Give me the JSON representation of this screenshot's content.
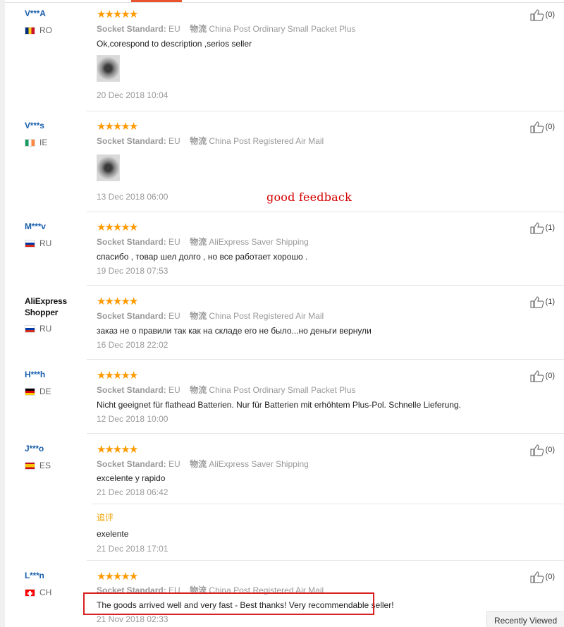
{
  "labels": {
    "socket_standard": "Socket Standard:",
    "logistics": "物流",
    "appended_review": "追评"
  },
  "watermark": "good feedback",
  "recently_viewed": "Recently Viewed",
  "rating_stars": 5,
  "reviews": [
    {
      "name": "V***A",
      "country": "RO",
      "flag_colors": [
        "#002b7f",
        "#fcd116",
        "#ce1126"
      ],
      "socket": "EU",
      "shipping": "China Post Ordinary Small Packet Plus",
      "text": "Ok,corespond to description ,serios seller",
      "has_photo": true,
      "date": "20 Dec 2018 10:04",
      "likes": "(0)"
    },
    {
      "name": "V***s",
      "country": "IE",
      "flag_colors": [
        "#169b62",
        "#ffffff",
        "#ff883e"
      ],
      "socket": "EU",
      "shipping": "China Post Registered Air Mail",
      "text": "",
      "has_photo": true,
      "date": "13 Dec 2018 06:00",
      "likes": "(0)"
    },
    {
      "name": "M***v",
      "country": "RU",
      "flag_colors": [
        "#ffffff",
        "#0039a6",
        "#d52b1e"
      ],
      "socket": "EU",
      "shipping": "AliExpress Saver Shipping",
      "text": "спасибо , товар шел долго , но все работает хорошо .",
      "has_photo": false,
      "date": "19 Dec 2018 07:53",
      "likes": "(1)"
    },
    {
      "name": "AliExpress Shopper",
      "country": "RU",
      "flag_colors": [
        "#ffffff",
        "#0039a6",
        "#d52b1e"
      ],
      "socket": "EU",
      "shipping": "China Post Registered Air Mail",
      "text": "заказ не о правили так как на складе его не было...но деньги вернули",
      "has_photo": false,
      "date": "16 Dec 2018 22:02",
      "likes": "(1)"
    },
    {
      "name": "H***h",
      "country": "DE",
      "flag_colors": [
        "#000000",
        "#dd0000",
        "#ffce00"
      ],
      "socket": "EU",
      "shipping": "China Post Ordinary Small Packet Plus",
      "text": "Nicht geeignet für flathead Batterien. Nur für Batterien mit erhöhtem Plus-Pol. Schnelle Lieferung.",
      "has_photo": false,
      "date": "12 Dec 2018 10:00",
      "likes": "(0)"
    },
    {
      "name": "J***o",
      "country": "ES",
      "flag_colors": [
        "#c60b1e",
        "#ffc400",
        "#c60b1e"
      ],
      "socket": "EU",
      "shipping": "AliExpress Saver Shipping",
      "text": "excelente y rapido",
      "has_photo": false,
      "date": "21 Dec 2018 06:42",
      "likes": "(0)",
      "appended_text": "exelente",
      "appended_date": "21 Dec 2018 17:01"
    },
    {
      "name": "L***n",
      "country": "CH",
      "flag_colors": [
        "#ff0000",
        "#ffffff",
        "#ff0000"
      ],
      "socket": "EU",
      "shipping": "China Post Registered Air Mail",
      "text": "The goods arrived well and very fast - Best thanks! Very recommendable seller!",
      "has_photo": false,
      "date": "21 Nov 2018 02:33",
      "likes": "(0)"
    }
  ]
}
